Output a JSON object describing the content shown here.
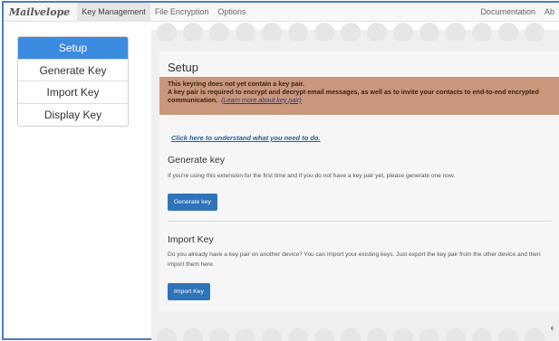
{
  "topbar": {
    "logo": "Mailvelope",
    "nav": [
      "Key Management",
      "File Encryption",
      "Options"
    ],
    "right": [
      "Documentation",
      "Ab"
    ]
  },
  "sidebar": {
    "items": [
      {
        "label": "Setup",
        "active": true
      },
      {
        "label": "Generate Key",
        "active": false
      },
      {
        "label": "Import Key",
        "active": false
      },
      {
        "label": "Display Key",
        "active": false
      }
    ]
  },
  "main": {
    "title": "Setup",
    "warning": {
      "line1": "This keyring does not yet contain a key pair.",
      "line2": "A key pair is required to encrypt and decrypt email messages, as well as to invite your contacts to end-to-end encrypted communication.",
      "learn_more": "(Learn more about key pair)"
    },
    "help_link": "Click here to understand what you need to do.",
    "generate": {
      "title": "Generate key",
      "text": "If you're using this extension for the first time and if you do not have a key pair yet, please generate one now.",
      "button": "Generate key"
    },
    "import": {
      "title": "Import Key",
      "text": "Do you already have a key pair on another device? You can import your existing keys. Just export the key pair from the other device and then import them here.",
      "button": "Import Key"
    }
  },
  "colors": {
    "accent": "#3b8be0",
    "button": "#2f73b8",
    "warning_bg": "#c9977c"
  }
}
